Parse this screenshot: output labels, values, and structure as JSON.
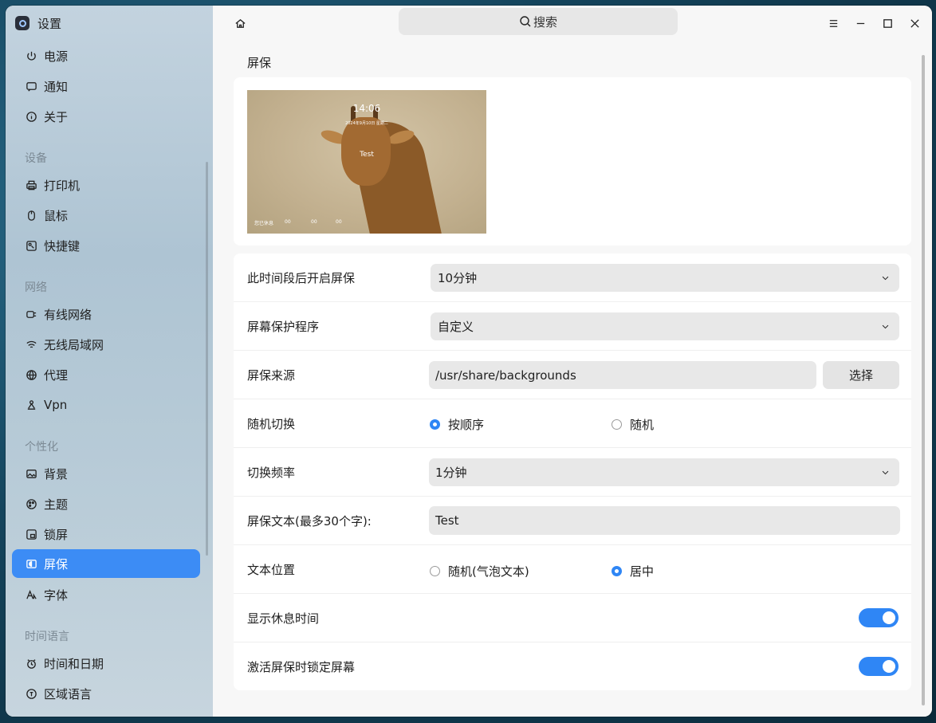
{
  "app": {
    "title": "设置"
  },
  "sidebar": {
    "items_top": [
      {
        "label": "电源",
        "icon": "power-icon"
      },
      {
        "label": "通知",
        "icon": "notification-icon"
      },
      {
        "label": "关于",
        "icon": "info-icon"
      }
    ],
    "groups": [
      {
        "label": "设备",
        "items": [
          {
            "label": "打印机",
            "icon": "printer-icon"
          },
          {
            "label": "鼠标",
            "icon": "mouse-icon"
          },
          {
            "label": "快捷键",
            "icon": "shortcut-icon"
          }
        ]
      },
      {
        "label": "网络",
        "items": [
          {
            "label": "有线网络",
            "icon": "wired-network-icon"
          },
          {
            "label": "无线局域网",
            "icon": "wifi-icon"
          },
          {
            "label": "代理",
            "icon": "proxy-icon"
          },
          {
            "label": "Vpn",
            "icon": "vpn-icon"
          }
        ]
      },
      {
        "label": "个性化",
        "items": [
          {
            "label": "背景",
            "icon": "background-icon"
          },
          {
            "label": "主题",
            "icon": "theme-icon"
          },
          {
            "label": "锁屏",
            "icon": "lockscreen-icon"
          },
          {
            "label": "屏保",
            "icon": "screensaver-icon",
            "active": true
          },
          {
            "label": "字体",
            "icon": "font-icon"
          }
        ]
      },
      {
        "label": "时间语言",
        "items": [
          {
            "label": "时间和日期",
            "icon": "clock-icon"
          },
          {
            "label": "区域语言",
            "icon": "region-language-icon"
          }
        ]
      }
    ]
  },
  "header": {
    "search_label": "搜索"
  },
  "page": {
    "title": "屏保",
    "preview": {
      "time": "14:06",
      "date": "2024年9月10日 星期二",
      "text": "Test",
      "rest_label": "您已休息",
      "rest_h": "00",
      "rest_m": "00",
      "rest_s": "00"
    },
    "settings": {
      "idle_label": "此时间段后开启屏保",
      "idle_value": "10分钟",
      "program_label": "屏幕保护程序",
      "program_value": "自定义",
      "source_label": "屏保来源",
      "source_value": "/usr/share/backgrounds",
      "choose_label": "选择",
      "switch_label": "随机切换",
      "switch_opt1": "按顺序",
      "switch_opt2": "随机",
      "switch_selected": "按顺序",
      "freq_label": "切换频率",
      "freq_value": "1分钟",
      "text_label": "屏保文本(最多30个字):",
      "text_value": "Test",
      "pos_label": "文本位置",
      "pos_opt1": "随机(气泡文本)",
      "pos_opt2": "居中",
      "pos_selected": "居中",
      "show_rest_label": "显示休息时间",
      "show_rest_on": true,
      "lock_label": "激活屏保时锁定屏幕",
      "lock_on": true
    }
  },
  "colors": {
    "accent": "#2f86f5",
    "active_nav": "#3c8cf5"
  }
}
